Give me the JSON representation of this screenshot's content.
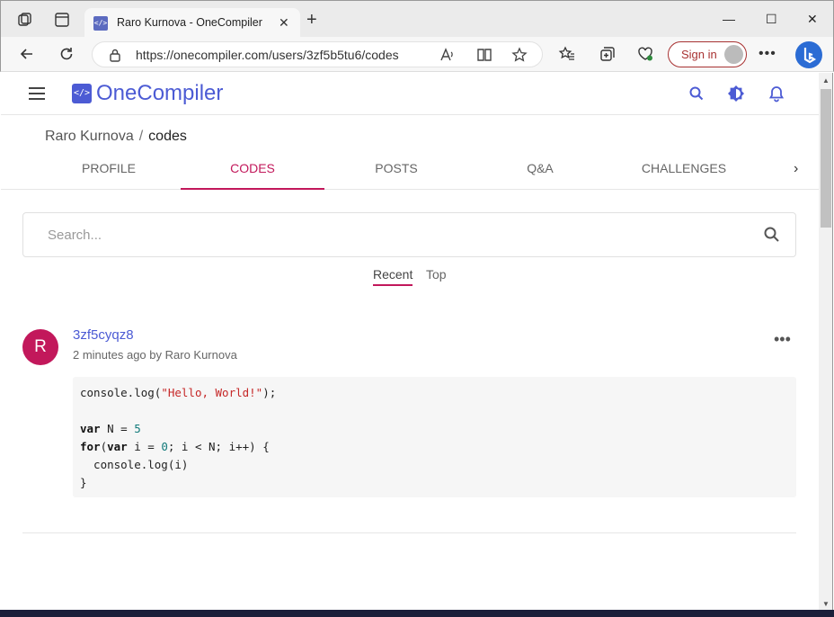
{
  "browser": {
    "tab_title": "Raro Kurnova - OneCompiler",
    "url": "https://onecompiler.com/users/3zf5b5tu6/codes",
    "sign_in_label": "Sign in",
    "accent_color": "#a83232"
  },
  "header": {
    "logo_text": "OneCompiler",
    "brand_color": "#4c5bd4"
  },
  "breadcrumb": {
    "user": "Raro Kurnova",
    "separator": "/",
    "current": "codes"
  },
  "tabs": [
    {
      "label": "PROFILE",
      "active": false
    },
    {
      "label": "CODES",
      "active": true
    },
    {
      "label": "POSTS",
      "active": false
    },
    {
      "label": "Q&A",
      "active": false
    },
    {
      "label": "CHALLENGES",
      "active": false
    }
  ],
  "search": {
    "placeholder": "Search..."
  },
  "sort": {
    "recent": "Recent",
    "top": "Top",
    "active": "Recent",
    "highlight_color": "#c2185b"
  },
  "posts": [
    {
      "avatar_letter": "R",
      "title": "3zf5cyqz8",
      "meta": "2 minutes ago by Raro Kurnova",
      "code_lines": [
        "console.log(\"Hello, World!\");",
        "",
        "var N = 5",
        "for(var i = 0; i < N; i++) {",
        "  console.log(i)",
        "}"
      ]
    }
  ],
  "icons": {
    "workspaces": "workspaces-icon",
    "tab_actions": "tab-actions-icon",
    "back": "back-arrow-icon",
    "refresh": "refresh-icon",
    "lock": "lock-icon",
    "read_aloud": "read-aloud-icon",
    "immersive_reader": "immersive-reader-icon",
    "favorite": "star-icon",
    "favorites": "favorites-icon",
    "collections": "collections-icon",
    "browser_essentials": "heart-pulse-icon",
    "more": "more-icon",
    "bing": "bing-icon",
    "menu": "hamburger-icon",
    "search": "search-icon",
    "theme": "theme-toggle-icon",
    "notifications": "bell-icon"
  }
}
